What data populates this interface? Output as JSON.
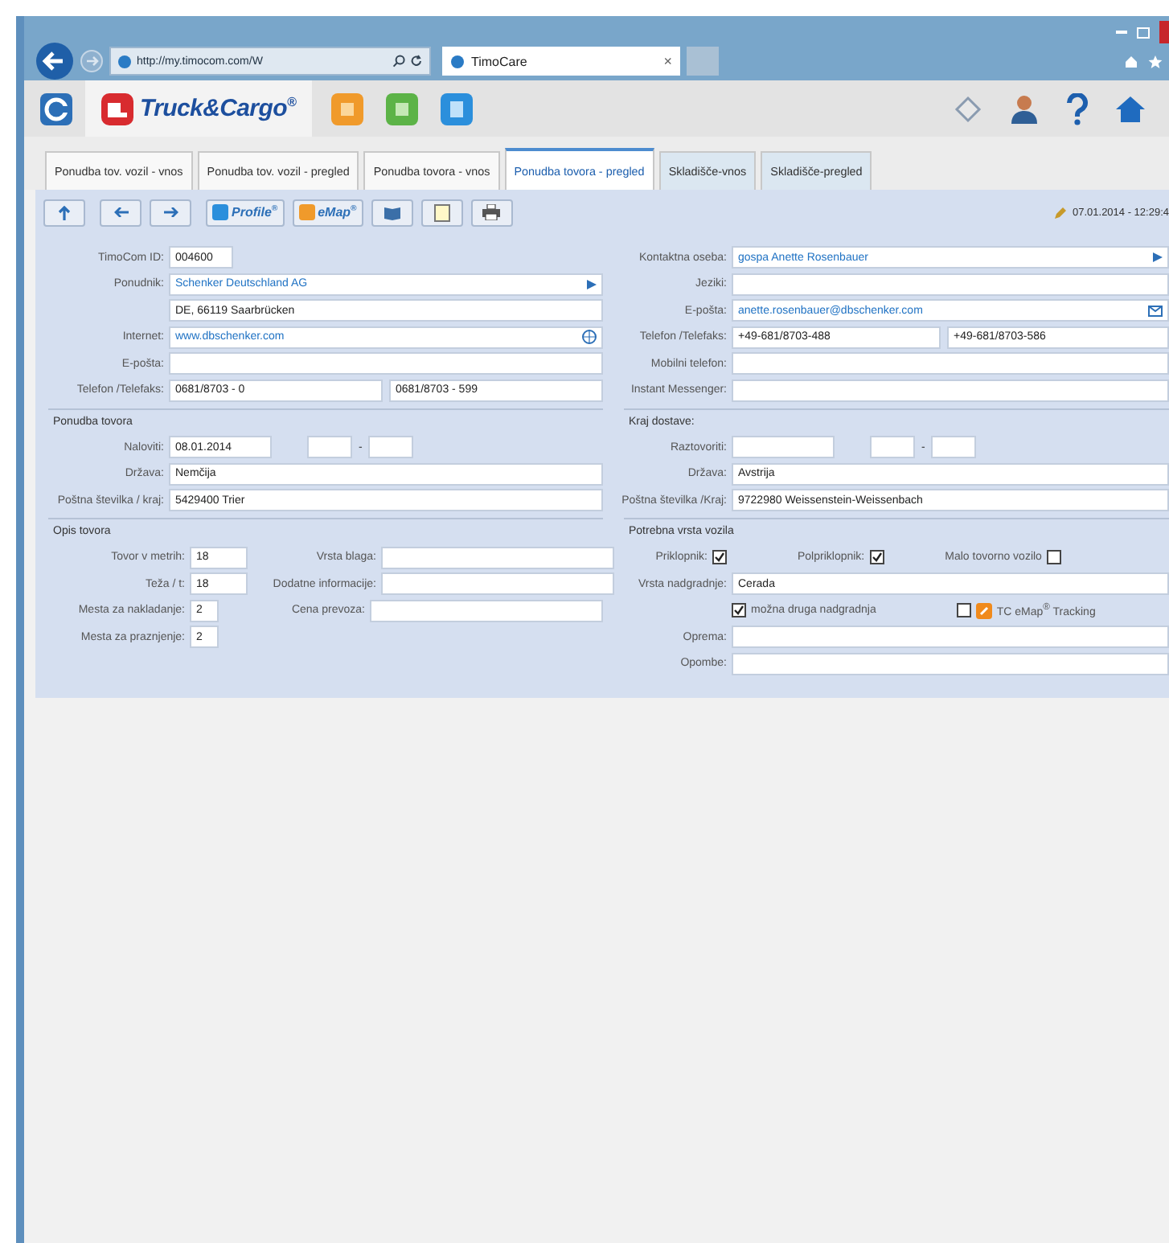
{
  "browser": {
    "address": "http://my.timocom.com/W",
    "tab_title": "TimoCare",
    "tab_close": "×"
  },
  "app": {
    "brand": "Truck&Cargo$^{®}$"
  },
  "tabs": [
    {
      "label": "Ponudba tov. vozil - vnos",
      "selected": false,
      "kind": "plain"
    },
    {
      "label": "Ponudba tov. vozil - pregled",
      "selected": false,
      "kind": "plain"
    },
    {
      "label": "Ponudba tovora - vnos",
      "selected": false,
      "kind": "plain"
    },
    {
      "label": "Ponudba tovora - pregled",
      "selected": true,
      "kind": "plain"
    },
    {
      "label": "Skladišče-vnos",
      "selected": false,
      "kind": "storage"
    },
    {
      "label": "Skladišče-pregled",
      "selected": false,
      "kind": "storage"
    }
  ],
  "toolbar": {
    "profile": "Profile$^{®}$",
    "emap": "eMap$^{®}$",
    "timestamp": "07.01.2014 - 12:29:4"
  },
  "form": {
    "left": [
      {
        "rows": [
          {
            "kind": "short",
            "label": "TimoCom ID:",
            "value": "004600"
          },
          {
            "kind": "wide-arrow",
            "label": "Ponudnik:",
            "value": "Schenker Deutschland AG",
            "link": true
          },
          {
            "kind": "wide",
            "value": "DE, 66119 Saarbrücken"
          },
          {
            "kind": "wide-globe",
            "label": "Internet:",
            "value": "www.dbschenker.com",
            "link": true
          },
          {
            "kind": "wide",
            "label": "E-pošta:"
          },
          {
            "kind": "pair",
            "label": "Telefon /Telefaks:",
            "value": "0681/8703 - 0",
            "value2": "0681/8703 - 599"
          }
        ]
      },
      {
        "title": "Ponudba tovora",
        "rows": [
          {
            "kind": "range",
            "label": "Naloviti:",
            "value": "08.01.2014",
            "dash": "-"
          },
          {
            "kind": "wide",
            "label": "Država:",
            "value": "Nemčija"
          },
          {
            "kind": "wide",
            "label": "Poštna številka / kraj:",
            "value": "5429400 Trier"
          }
        ]
      },
      {
        "title": "Opis tovora",
        "rows": [
          {
            "kind": "split",
            "label": "Tovor v metrih:",
            "value": "18",
            "label2": "Vrsta blaga:"
          },
          {
            "kind": "split",
            "label": "Teža / t:",
            "value": "18",
            "label2": "Dodatne informacije:"
          },
          {
            "kind": "split-tiny",
            "label": "Mesta za nakladanje:",
            "value": "2",
            "label2": "Cena prevoza:"
          },
          {
            "kind": "split-tiny",
            "label": "Mesta za praznjenje:",
            "value": "2"
          }
        ]
      }
    ],
    "right": [
      {
        "rows": [
          {
            "kind": "wide-arrow",
            "label": "Kontaktna oseba:",
            "value": "gospa Anette Rosenbauer",
            "link": true
          },
          {
            "kind": "wide",
            "label": "Jeziki:"
          },
          {
            "kind": "wide-mail",
            "label": "E-pošta:",
            "value": "anette.rosenbauer@dbschenker.com",
            "link": true
          },
          {
            "kind": "pair",
            "label": "Telefon /Telefaks:",
            "value": "+49-681/8703-488",
            "value2": "+49-681/8703-586"
          },
          {
            "kind": "wide",
            "label": "Mobilni telefon:"
          },
          {
            "kind": "wide",
            "label": "Instant Messenger:"
          }
        ]
      },
      {
        "title": "Kraj dostave:",
        "rows": [
          {
            "kind": "range",
            "label": "Raztovoriti:",
            "dash": "-"
          },
          {
            "kind": "wide",
            "label": "Država:",
            "value": "Avstrija"
          },
          {
            "kind": "wide",
            "label": "Poštna številka /Kraj:",
            "value": "9722980 Weissenstein-Weissenbach"
          }
        ]
      },
      {
        "title": "Potrebna vrsta vozila",
        "rows": [
          {
            "kind": "checks",
            "items": [
              {
                "label": "Priklopnik:",
                "checked": true
              },
              {
                "label": "Polpriklopnik:",
                "checked": true
              },
              {
                "label": "Malo tovorno vozilo",
                "checked": false
              }
            ]
          },
          {
            "kind": "wide",
            "label": "Vrsta nadgradnje:",
            "value": "Cerada"
          },
          {
            "kind": "options",
            "items": [
              {
                "label": "možna druga nadgradnja",
                "checked": true,
                "kind": "plain"
              },
              {
                "label": "TC eMap$^{®}$ Tracking",
                "checked": false,
                "kind": "tracking"
              }
            ]
          },
          {
            "kind": "wide",
            "label": "Oprema:"
          },
          {
            "kind": "wide",
            "label": "Opombe:"
          }
        ]
      }
    ]
  }
}
